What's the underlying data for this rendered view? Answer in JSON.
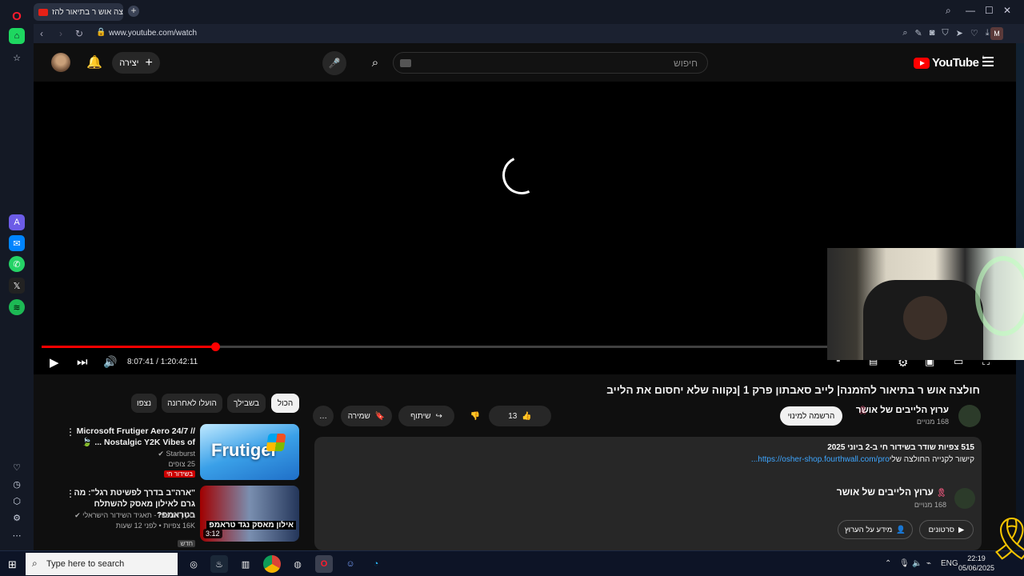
{
  "browser": {
    "tab_title": "חולצה אוש ר בתיאור להז",
    "url": "www.youtube.com/watch",
    "profile_initial": "M"
  },
  "youtube": {
    "search_placeholder": "חיפוש",
    "create_label": "יצירה",
    "logo_text": "YouTube",
    "logo_region": "IL"
  },
  "player": {
    "time_display": "8:07:41 / 1:20:42:11",
    "progress_fraction": 0.18
  },
  "video": {
    "title": "חולצה אוש ר בתיאור להזמנה| לייב סאבתון פרק 1 |נקווה שלא יחסום את הלייב",
    "channel_name": "ערוץ הלייבים של אושר",
    "channel_subs": "168 מנויים",
    "subscribe_label": "הרשמה למינוי",
    "like_count": "13",
    "share_label": "שיתוף",
    "save_label": "שמירה",
    "more_label": "…"
  },
  "description": {
    "meta": "515 צפיות  שודר בשידור חי ב-2 ביוני 2025",
    "text_prefix": "קישור לקנייה החולצה שלי",
    "link": "https://osher-shop.fourthwall.com/pro...",
    "channel_name": "ערוץ הלייבים של אושר",
    "channel_subs": "168 מנויים",
    "videos_label": "סרטונים",
    "about_label": "מידע על הערוץ"
  },
  "chips": [
    "הכול",
    "בשבילך",
    "הועלו לאחרונה",
    "נצפו"
  ],
  "recommendations": [
    {
      "title": "Microsoft Frutiger Aero 24/7 // Nostalgic Y2K Vibes of ... 🍃",
      "channel": "Starburst",
      "views": "25 צופים",
      "badge": "בשידור חי",
      "thumb_text": "Frutiger"
    },
    {
      "title": "\"ארה\"ב בדרך לפשיטת רגל\": מה גרם לאילון מאסק להשתלח בטראמפ?",
      "channel": "כאן | חדשות - תאגיד השידור הישראלי",
      "views": "16K צפיות  •  לפני 12 שעות",
      "badge": "חדש",
      "duration": "3:12",
      "thumb_text": "אילון מאסק נגד טראמפ"
    }
  ],
  "taskbar": {
    "search_placeholder": "Type here to search",
    "lang": "ENG",
    "time": "22:19",
    "date": "05/06/2025"
  }
}
